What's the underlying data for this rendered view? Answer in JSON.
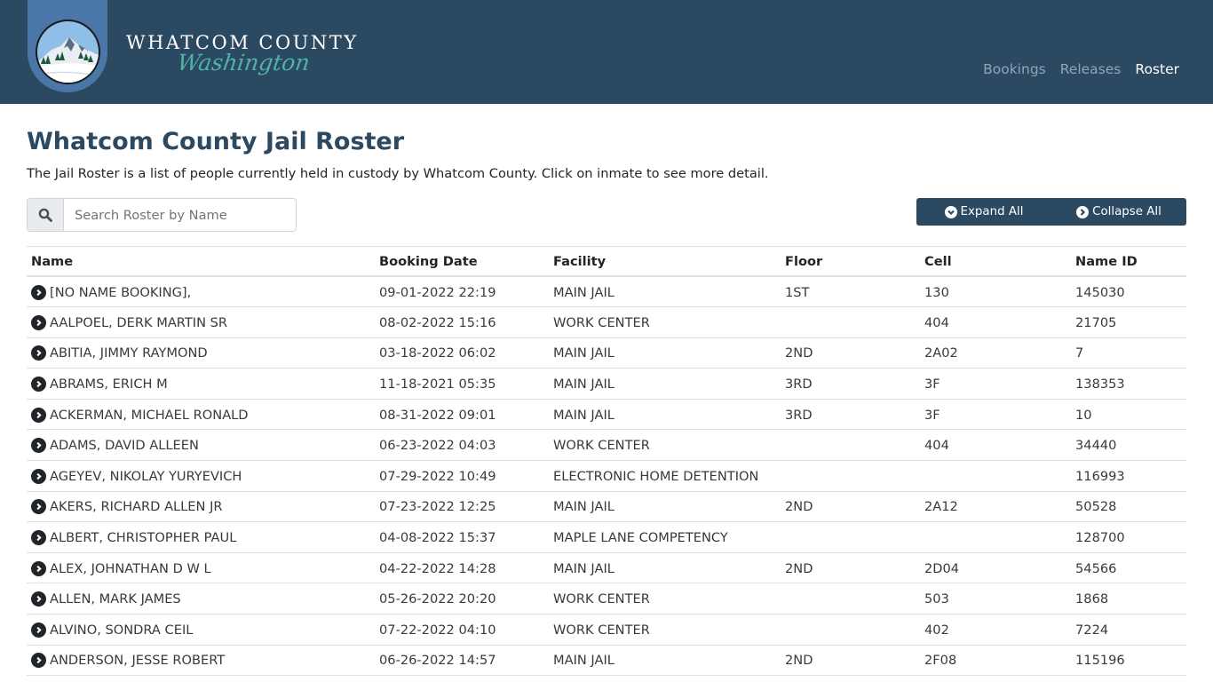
{
  "header": {
    "brand_top": "WHATCOM COUNTY",
    "brand_script": "Washington",
    "logo_icon": "mountain-landscape-seal",
    "nav": [
      {
        "label": "Bookings",
        "active": false
      },
      {
        "label": "Releases",
        "active": false
      },
      {
        "label": "Roster",
        "active": true
      }
    ],
    "colors": {
      "background": "#2c4962",
      "logo_tab": "#4a77a8",
      "script_accent": "#4fb3a6"
    }
  },
  "page": {
    "title": "Whatcom County Jail Roster",
    "description": "The Jail Roster is a list of people currently held in custody by Whatcom County. Click on inmate to see more detail."
  },
  "search": {
    "icon": "search-icon",
    "placeholder": "Search Roster by Name",
    "value": ""
  },
  "actions": {
    "expand_all": {
      "label": "Expand All",
      "icon": "chevron-circle-down-icon"
    },
    "collapse_all": {
      "label": "Collapse All",
      "icon": "chevron-circle-right-icon"
    }
  },
  "table": {
    "columns": [
      "Name",
      "Booking Date",
      "Facility",
      "Floor",
      "Cell",
      "Name ID"
    ],
    "rows": [
      {
        "name": "[NO NAME BOOKING],",
        "booking_date": "09-01-2022 22:19",
        "facility": "MAIN JAIL",
        "floor": "1ST",
        "cell": "130",
        "name_id": "145030"
      },
      {
        "name": "AALPOEL, DERK MARTIN SR",
        "booking_date": "08-02-2022 15:16",
        "facility": "WORK CENTER",
        "floor": "",
        "cell": "404",
        "name_id": "21705"
      },
      {
        "name": "ABITIA, JIMMY RAYMOND",
        "booking_date": "03-18-2022 06:02",
        "facility": "MAIN JAIL",
        "floor": "2ND",
        "cell": "2A02",
        "name_id": "7"
      },
      {
        "name": "ABRAMS, ERICH M",
        "booking_date": "11-18-2021 05:35",
        "facility": "MAIN JAIL",
        "floor": "3RD",
        "cell": "3F",
        "name_id": "138353"
      },
      {
        "name": "ACKERMAN, MICHAEL RONALD",
        "booking_date": "08-31-2022 09:01",
        "facility": "MAIN JAIL",
        "floor": "3RD",
        "cell": "3F",
        "name_id": "10"
      },
      {
        "name": "ADAMS, DAVID ALLEEN",
        "booking_date": "06-23-2022 04:03",
        "facility": "WORK CENTER",
        "floor": "",
        "cell": "404",
        "name_id": "34440"
      },
      {
        "name": "AGEYEV, NIKOLAY YURYEVICH",
        "booking_date": "07-29-2022 10:49",
        "facility": "ELECTRONIC HOME DETENTION",
        "floor": "",
        "cell": "",
        "name_id": "116993"
      },
      {
        "name": "AKERS, RICHARD ALLEN JR",
        "booking_date": "07-23-2022 12:25",
        "facility": "MAIN JAIL",
        "floor": "2ND",
        "cell": "2A12",
        "name_id": "50528"
      },
      {
        "name": "ALBERT, CHRISTOPHER PAUL",
        "booking_date": "04-08-2022 15:37",
        "facility": "MAPLE LANE COMPETENCY",
        "floor": "",
        "cell": "",
        "name_id": "128700"
      },
      {
        "name": "ALEX, JOHNATHAN D W L",
        "booking_date": "04-22-2022 14:28",
        "facility": "MAIN JAIL",
        "floor": "2ND",
        "cell": "2D04",
        "name_id": "54566"
      },
      {
        "name": "ALLEN, MARK JAMES",
        "booking_date": "05-26-2022 20:20",
        "facility": "WORK CENTER",
        "floor": "",
        "cell": "503",
        "name_id": "1868"
      },
      {
        "name": "ALVINO, SONDRA CEIL",
        "booking_date": "07-22-2022 04:10",
        "facility": "WORK CENTER",
        "floor": "",
        "cell": "402",
        "name_id": "7224"
      },
      {
        "name": "ANDERSON, JESSE ROBERT",
        "booking_date": "06-26-2022 14:57",
        "facility": "MAIN JAIL",
        "floor": "2ND",
        "cell": "2F08",
        "name_id": "115196"
      }
    ]
  }
}
